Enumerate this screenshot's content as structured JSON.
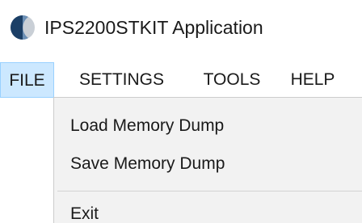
{
  "window": {
    "title": "IPS2200STKIT Application",
    "icon": "app-logo-icon"
  },
  "menubar": {
    "items": [
      {
        "label": "FILE",
        "active": true
      },
      {
        "label": "SETTINGS",
        "active": false
      },
      {
        "label": "TOOLS",
        "active": false
      },
      {
        "label": "HELP",
        "active": false
      }
    ]
  },
  "file_menu": {
    "items": [
      {
        "label": "Load Memory Dump"
      },
      {
        "label": "Save Memory Dump"
      },
      {
        "label": "Exit"
      }
    ]
  },
  "colors": {
    "active_menu_bg": "#cce8ff",
    "active_menu_border": "#99d1ff",
    "dropdown_bg": "#f2f2f2",
    "icon_dark": "#1b3f66",
    "icon_light": "#c9cfd6"
  }
}
